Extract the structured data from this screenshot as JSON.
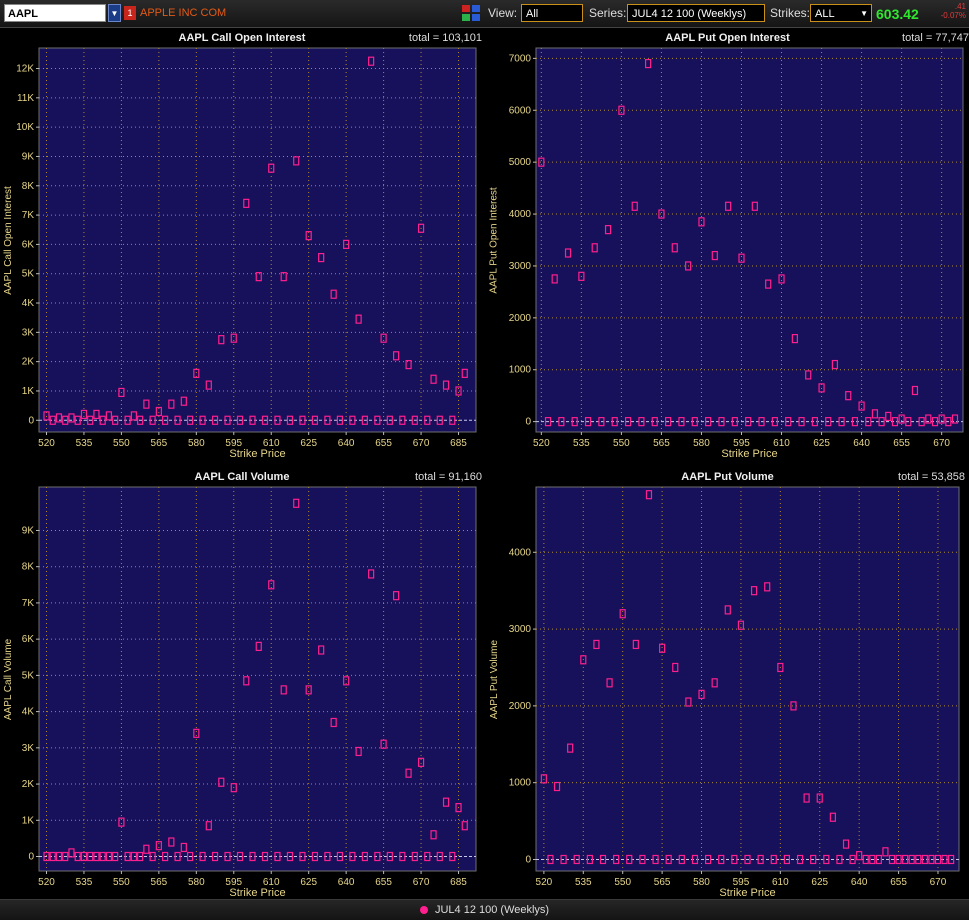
{
  "toolbar": {
    "symbol": "AAPL",
    "link_badge": "1",
    "company": "APPLE INC COM",
    "view_label": "View:",
    "view_value": "All",
    "series_label": "Series:",
    "series_value": "JUL4 12 100 (Weeklys)",
    "strikes_label": "Strikes:",
    "strikes_value": "ALL",
    "price": "603.42",
    "change": ".41",
    "change_pct": "-0.07%"
  },
  "legend": {
    "series": "JUL4 12 100 (Weeklys)"
  },
  "colors": {
    "plot_bg": "#16115a",
    "marker": "#ff1f8e",
    "axis_text": "#e6d58a",
    "grid": "#b08a2a"
  },
  "chart_data": [
    {
      "type": "scatter",
      "title": "AAPL Call Open Interest",
      "total": "total = 103,101",
      "xlabel": "Strike Price",
      "ylabel": "AAPL Call Open Interest",
      "xlim": [
        517,
        692
      ],
      "ylim": [
        -400,
        12700
      ],
      "xticks": [
        520,
        535,
        550,
        565,
        580,
        595,
        610,
        625,
        640,
        655,
        670,
        685
      ],
      "yticks": [
        0,
        1000,
        2000,
        3000,
        4000,
        5000,
        6000,
        7000,
        8000,
        9000,
        10000,
        11000,
        12000
      ],
      "yticklabels": [
        "0",
        "1K",
        "2K",
        "3K",
        "4K",
        "5K",
        "6K",
        "7K",
        "8K",
        "9K",
        "10K",
        "11K",
        "12K"
      ],
      "x": [
        520,
        522.5,
        525,
        527.5,
        530,
        532.5,
        535,
        537.5,
        540,
        542.5,
        545,
        547.5,
        550,
        552.5,
        555,
        557.5,
        560,
        562.5,
        565,
        567.5,
        570,
        572.5,
        575,
        577.5,
        580,
        582.5,
        585,
        587.5,
        590,
        592.5,
        595,
        597.5,
        600,
        602.5,
        605,
        607.5,
        610,
        612.5,
        615,
        617.5,
        620,
        622.5,
        625,
        627.5,
        630,
        632.5,
        635,
        637.5,
        640,
        642.5,
        645,
        647.5,
        650,
        652.5,
        655,
        657.5,
        660,
        662.5,
        665,
        667.5,
        670,
        672.5,
        675,
        677.5,
        680,
        682.5,
        685,
        687.5
      ],
      "y": [
        150,
        0,
        80,
        0,
        80,
        0,
        200,
        0,
        200,
        0,
        150,
        0,
        950,
        0,
        150,
        0,
        550,
        0,
        300,
        0,
        550,
        0,
        650,
        0,
        1600,
        0,
        1200,
        0,
        2750,
        0,
        2800,
        0,
        7400,
        0,
        4900,
        0,
        8600,
        0,
        4900,
        0,
        8850,
        0,
        6300,
        0,
        5550,
        0,
        4300,
        0,
        6000,
        0,
        3450,
        0,
        12250,
        0,
        2800,
        0,
        2200,
        0,
        1900,
        0,
        6550,
        0,
        1400,
        0,
        1200,
        0,
        1000,
        1600
      ]
    },
    {
      "type": "scatter",
      "title": "AAPL Put Open Interest",
      "total": "total = 77,747",
      "xlabel": "Strike Price",
      "ylabel": "AAPL Put Open Interest",
      "xlim": [
        518,
        678
      ],
      "ylim": [
        -200,
        7200
      ],
      "xticks": [
        520,
        535,
        550,
        565,
        580,
        595,
        610,
        625,
        640,
        655,
        670
      ],
      "yticks": [
        0,
        1000,
        2000,
        3000,
        4000,
        5000,
        6000,
        7000
      ],
      "yticklabels": [
        "0",
        "1000",
        "2000",
        "3000",
        "4000",
        "5000",
        "6000",
        "7000"
      ],
      "x": [
        520,
        522.5,
        525,
        527.5,
        530,
        532.5,
        535,
        537.5,
        540,
        542.5,
        545,
        547.5,
        550,
        552.5,
        555,
        557.5,
        560,
        562.5,
        565,
        567.5,
        570,
        572.5,
        575,
        577.5,
        580,
        582.5,
        585,
        587.5,
        590,
        592.5,
        595,
        597.5,
        600,
        602.5,
        605,
        607.5,
        610,
        612.5,
        615,
        617.5,
        620,
        622.5,
        625,
        627.5,
        630,
        632.5,
        635,
        637.5,
        640,
        642.5,
        645,
        647.5,
        650,
        652.5,
        655,
        657.5,
        660,
        662.5,
        665,
        667.5,
        670,
        672.5,
        675
      ],
      "y": [
        5000,
        0,
        2750,
        0,
        3250,
        0,
        2800,
        0,
        3350,
        0,
        3700,
        0,
        6000,
        0,
        4150,
        0,
        6900,
        0,
        4000,
        0,
        3350,
        0,
        3000,
        0,
        3850,
        0,
        3200,
        0,
        4150,
        0,
        3150,
        0,
        4150,
        0,
        2650,
        0,
        2750,
        0,
        1600,
        0,
        900,
        0,
        650,
        0,
        1100,
        0,
        500,
        0,
        300,
        0,
        150,
        0,
        100,
        0,
        50,
        0,
        600,
        0,
        50,
        0,
        50,
        0,
        50,
        0,
        50
      ]
    },
    {
      "type": "scatter",
      "title": "AAPL Call Volume",
      "total": "total = 91,160",
      "xlabel": "Strike Price",
      "ylabel": "AAPL Call Volume",
      "xlim": [
        517,
        692
      ],
      "ylim": [
        -400,
        10200
      ],
      "xticks": [
        520,
        535,
        550,
        565,
        580,
        595,
        610,
        625,
        640,
        655,
        670,
        685
      ],
      "yticks": [
        0,
        1000,
        2000,
        3000,
        4000,
        5000,
        6000,
        7000,
        8000,
        9000
      ],
      "yticklabels": [
        "0",
        "1K",
        "2K",
        "3K",
        "4K",
        "5K",
        "6K",
        "7K",
        "8K",
        "9K"
      ],
      "x": [
        520,
        522.5,
        525,
        527.5,
        530,
        532.5,
        535,
        537.5,
        540,
        542.5,
        545,
        547.5,
        550,
        552.5,
        555,
        557.5,
        560,
        562.5,
        565,
        567.5,
        570,
        572.5,
        575,
        577.5,
        580,
        582.5,
        585,
        587.5,
        590,
        592.5,
        595,
        597.5,
        600,
        602.5,
        605,
        607.5,
        610,
        612.5,
        615,
        617.5,
        620,
        622.5,
        625,
        627.5,
        630,
        632.5,
        635,
        637.5,
        640,
        642.5,
        645,
        647.5,
        650,
        652.5,
        655,
        657.5,
        660,
        662.5,
        665,
        667.5,
        670,
        672.5,
        675,
        677.5,
        680,
        682.5,
        685,
        687.5
      ],
      "y": [
        0,
        0,
        0,
        0,
        100,
        0,
        0,
        0,
        0,
        0,
        0,
        0,
        950,
        0,
        0,
        0,
        200,
        0,
        300,
        0,
        400,
        0,
        250,
        0,
        3400,
        0,
        850,
        0,
        2050,
        0,
        1900,
        0,
        4850,
        0,
        5800,
        0,
        7500,
        0,
        4600,
        0,
        9750,
        0,
        4600,
        0,
        5700,
        0,
        3700,
        0,
        4850,
        0,
        2900,
        0,
        7800,
        0,
        3100,
        0,
        7200,
        0,
        2300,
        0,
        2600,
        0,
        600,
        0,
        1500,
        0,
        1350,
        850
      ]
    },
    {
      "type": "scatter",
      "title": "AAPL Put Volume",
      "total": "total = 53,858",
      "xlabel": "Strike Price",
      "ylabel": "AAPL Put Volume",
      "xlim": [
        517,
        678
      ],
      "ylim": [
        -150,
        4850
      ],
      "xticks": [
        520,
        535,
        550,
        565,
        580,
        595,
        610,
        625,
        640,
        655,
        670
      ],
      "yticks": [
        0,
        1000,
        2000,
        3000,
        4000
      ],
      "yticklabels": [
        "0",
        "1000",
        "2000",
        "3000",
        "4000"
      ],
      "x": [
        520,
        522.5,
        525,
        527.5,
        530,
        532.5,
        535,
        537.5,
        540,
        542.5,
        545,
        547.5,
        550,
        552.5,
        555,
        557.5,
        560,
        562.5,
        565,
        567.5,
        570,
        572.5,
        575,
        577.5,
        580,
        582.5,
        585,
        587.5,
        590,
        592.5,
        595,
        597.5,
        600,
        602.5,
        605,
        607.5,
        610,
        612.5,
        615,
        617.5,
        620,
        622.5,
        625,
        627.5,
        630,
        632.5,
        635,
        637.5,
        640,
        642.5,
        645,
        647.5,
        650,
        652.5,
        655,
        657.5,
        660,
        662.5,
        665,
        667.5,
        670,
        672.5,
        675
      ],
      "y": [
        1050,
        0,
        950,
        0,
        1450,
        0,
        2600,
        0,
        2800,
        0,
        2300,
        0,
        3200,
        0,
        2800,
        0,
        4750,
        0,
        2750,
        0,
        2500,
        0,
        2050,
        0,
        2150,
        0,
        2300,
        0,
        3250,
        0,
        3050,
        0,
        3500,
        0,
        3550,
        0,
        2500,
        0,
        2000,
        0,
        800,
        0,
        800,
        0,
        550,
        0,
        200,
        0,
        50,
        0,
        0,
        0,
        100,
        0,
        0,
        0,
        0,
        0,
        0,
        0,
        0,
        0,
        0
      ]
    }
  ]
}
